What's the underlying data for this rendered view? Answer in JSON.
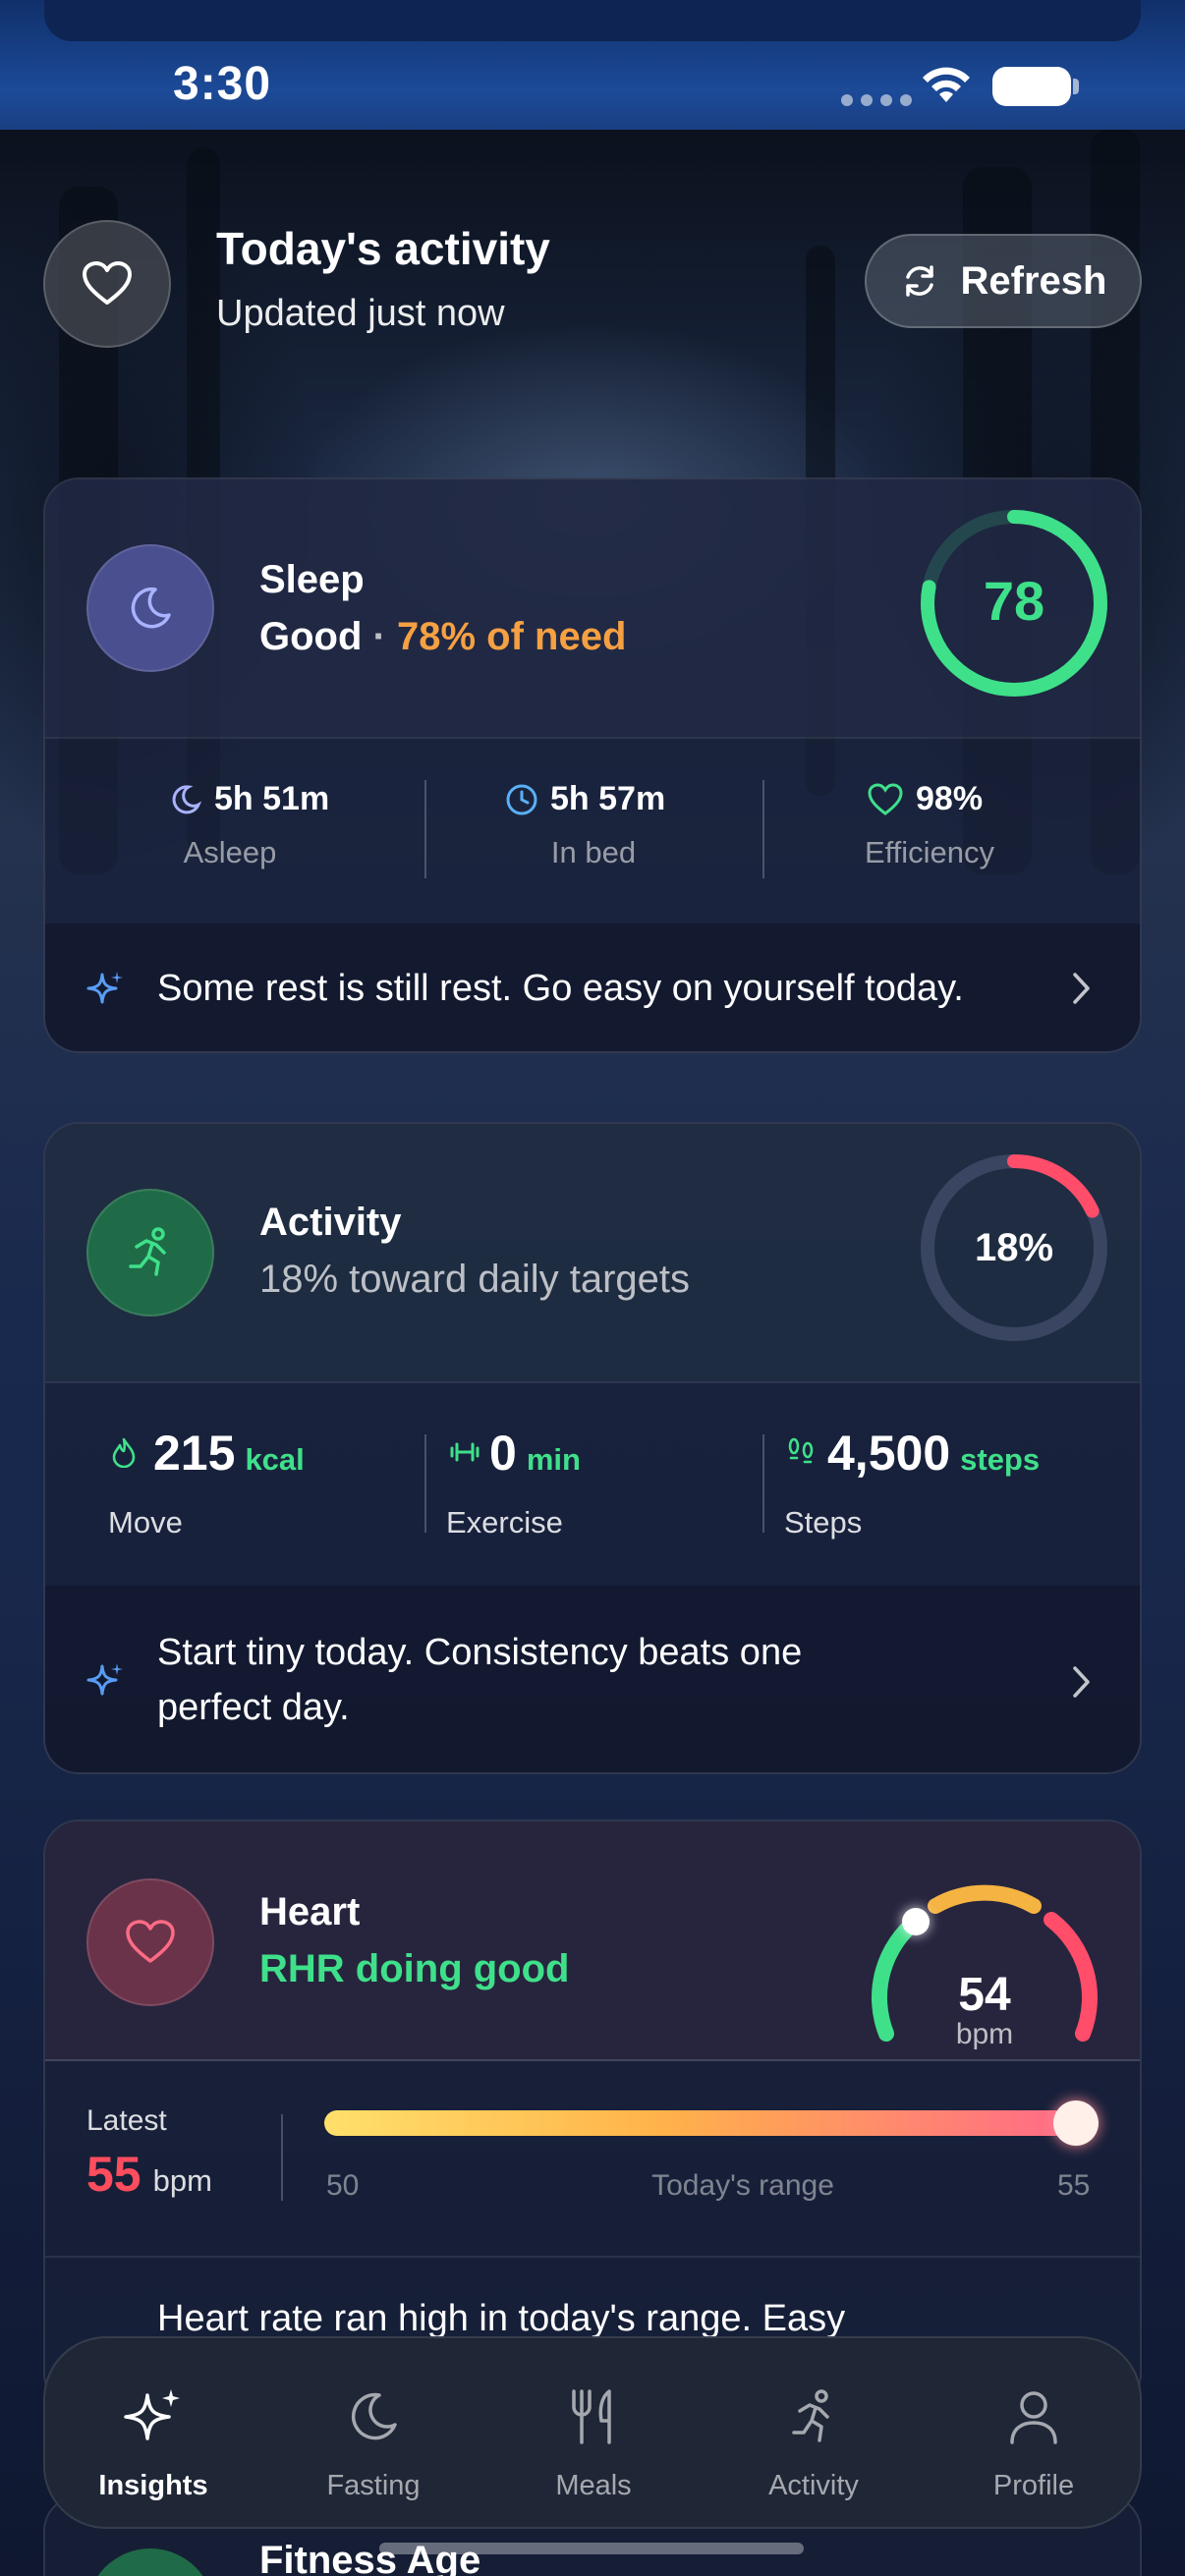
{
  "status_bar": {
    "time": "3:30"
  },
  "header": {
    "title": "Today's activity",
    "subtitle": "Updated just now",
    "refresh_label": "Refresh"
  },
  "sleep": {
    "title": "Sleep",
    "quality": "Good",
    "separator": "·",
    "need": "78% of need",
    "score": "78",
    "score_fraction": 0.78,
    "stats": [
      {
        "value": "5h 51m",
        "label": "Asleep"
      },
      {
        "value": "5h 57m",
        "label": "In bed"
      },
      {
        "value": "98%",
        "label": "Efficiency"
      }
    ],
    "tip": "Some rest is still rest. Go easy on yourself today."
  },
  "activity": {
    "title": "Activity",
    "subtitle": "18% toward daily targets",
    "ring_label": "18%",
    "ring_fraction": 0.18,
    "stats": [
      {
        "value": "215",
        "unit": "kcal",
        "label": "Move"
      },
      {
        "value": "0",
        "unit": "min",
        "label": "Exercise"
      },
      {
        "value": "4,500",
        "unit": "steps",
        "label": "Steps"
      }
    ],
    "tip_line1": "Start tiny today. Consistency beats one",
    "tip_line2": "perfect day."
  },
  "heart": {
    "title": "Heart",
    "subtitle": "RHR doing good",
    "gauge_value": "54",
    "gauge_unit": "bpm",
    "latest_label": "Latest",
    "latest_value": "55",
    "latest_unit": "bpm",
    "range_min": "50",
    "range_label": "Today's range",
    "range_max": "55",
    "tip": "Heart rate ran high in today's range. Easy"
  },
  "next_card_title": "Fitness Age",
  "tabs": [
    {
      "label": "Insights",
      "icon": "sparkles-icon",
      "active": true
    },
    {
      "label": "Fasting",
      "icon": "moon-icon",
      "active": false
    },
    {
      "label": "Meals",
      "icon": "fork-knife-icon",
      "active": false
    },
    {
      "label": "Activity",
      "icon": "running-icon",
      "active": false
    },
    {
      "label": "Profile",
      "icon": "person-icon",
      "active": false
    }
  ],
  "colors": {
    "accent_green": "#3fe08a",
    "accent_orange": "#f5a042",
    "heart_red": "#ff4d5e",
    "activity_ring": "#ff4d6a",
    "sleep_icon_bg": "#4a4f8f",
    "activity_icon_bg": "#1f6b47",
    "heart_icon_bg": "#6b3349"
  }
}
